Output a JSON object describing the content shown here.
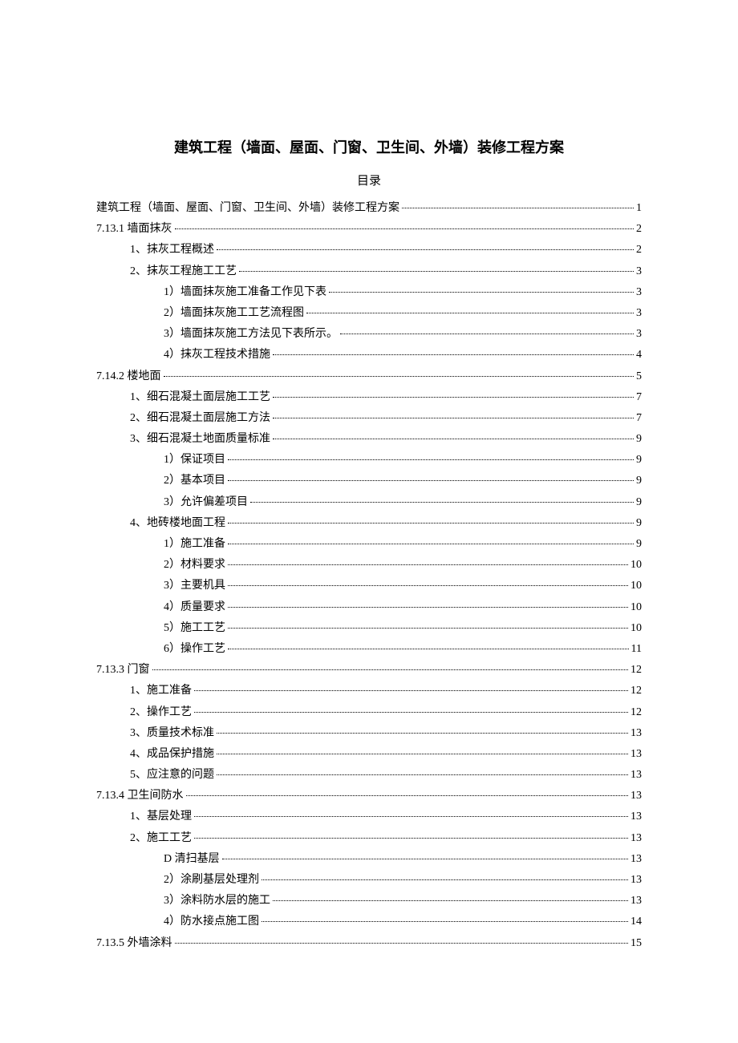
{
  "title": "建筑工程（墙面、屋面、门窗、卫生间、外墙）装修工程方案",
  "subtitle": "目录",
  "toc": [
    {
      "label": "建筑工程（墙面、屋面、门窗、卫生间、外墙）装修工程方案",
      "page": "1",
      "indent": 0
    },
    {
      "label": "7.13.1 墙面抹灰",
      "page": "2",
      "indent": 0
    },
    {
      "label": "1、抹灰工程概述",
      "page": "2",
      "indent": 1
    },
    {
      "label": "2、抹灰工程施工工艺",
      "page": "3",
      "indent": 1
    },
    {
      "label": "1）墙面抹灰施工准备工作见下表",
      "page": "3",
      "indent": 2
    },
    {
      "label": "2）墙面抹灰施工工艺流程图",
      "page": "3",
      "indent": 2
    },
    {
      "label": "3）墙面抹灰施工方法见下表所示。",
      "page": "3",
      "indent": 2
    },
    {
      "label": "4）抹灰工程技术措施",
      "page": "4",
      "indent": 2
    },
    {
      "label": "7.14.2 楼地面",
      "page": "5",
      "indent": 0
    },
    {
      "label": "1、细石混凝土面层施工工艺",
      "page": "7",
      "indent": 1
    },
    {
      "label": "2、细石混凝土面层施工方法",
      "page": "7",
      "indent": 1
    },
    {
      "label": "3、细石混凝土地面质量标准",
      "page": "9",
      "indent": 1
    },
    {
      "label": "1）保证项目",
      "page": "9",
      "indent": 2
    },
    {
      "label": "2）基本项目",
      "page": "9",
      "indent": 2
    },
    {
      "label": "3）允许偏差项目",
      "page": "9",
      "indent": 2
    },
    {
      "label": "4、地砖楼地面工程",
      "page": "9",
      "indent": 1
    },
    {
      "label": "1）施工准备",
      "page": "9",
      "indent": 2
    },
    {
      "label": "2）材料要求",
      "page": "10",
      "indent": 2
    },
    {
      "label": "3）主要机具",
      "page": "10",
      "indent": 2
    },
    {
      "label": "4）质量要求",
      "page": "10",
      "indent": 2
    },
    {
      "label": "5）施工工艺",
      "page": "10",
      "indent": 2
    },
    {
      "label": "6）操作工艺",
      "page": "11",
      "indent": 2
    },
    {
      "label": "7.13.3 门窗",
      "page": "12",
      "indent": 0
    },
    {
      "label": "1、施工准备",
      "page": "12",
      "indent": 1
    },
    {
      "label": "2、操作工艺",
      "page": "12",
      "indent": 1
    },
    {
      "label": "3、质量技术标准",
      "page": "13",
      "indent": 1
    },
    {
      "label": "4、成品保护措施",
      "page": "13",
      "indent": 1
    },
    {
      "label": "5、应注意的问题",
      "page": "13",
      "indent": 1
    },
    {
      "label": "7.13.4 卫生间防水",
      "page": "13",
      "indent": 0
    },
    {
      "label": "1、基层处理",
      "page": "13",
      "indent": 1
    },
    {
      "label": "2、施工工艺",
      "page": "13",
      "indent": 1
    },
    {
      "label": "D 清扫基层",
      "page": "13",
      "indent": 2
    },
    {
      "label": "2）涂刷基层处理剂",
      "page": "13",
      "indent": 2
    },
    {
      "label": "3）涂料防水层的施工",
      "page": "13",
      "indent": 2
    },
    {
      "label": "4）防水接点施工图",
      "page": "14",
      "indent": 2
    },
    {
      "label": "7.13.5 外墙涂料",
      "page": "15",
      "indent": 0
    }
  ]
}
